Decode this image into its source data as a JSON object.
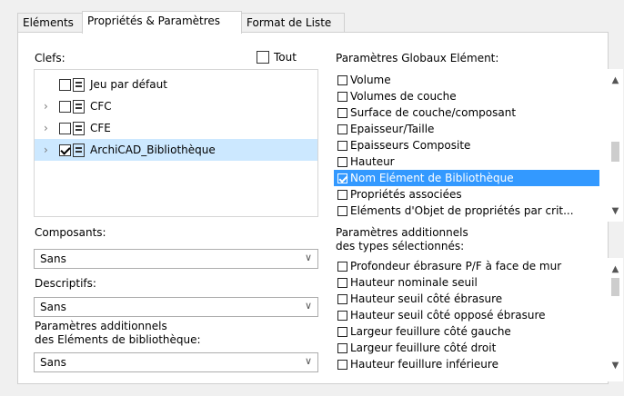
{
  "tabs": [
    {
      "label": "Eléments"
    },
    {
      "label": "Propriétés & Paramètres"
    },
    {
      "label": "Format de Liste"
    }
  ],
  "left": {
    "clefs_label": "Clefs:",
    "tout_label": "Tout",
    "tree": [
      {
        "label": "Jeu par défaut",
        "checked": false,
        "expandable": false
      },
      {
        "label": "CFC",
        "checked": false,
        "expandable": true
      },
      {
        "label": "CFE",
        "checked": false,
        "expandable": true
      },
      {
        "label": "ArchiCAD_Bibliothèque",
        "checked": true,
        "expandable": true
      }
    ],
    "composants_label": "Composants:",
    "composants_value": "Sans",
    "descriptifs_label": "Descriptifs:",
    "descriptifs_value": "Sans",
    "params_label_1": "Paramètres additionnels",
    "params_label_2": "des Eléments de bibliothèque:",
    "params_value": "Sans"
  },
  "right": {
    "global_label": "Paramètres Globaux Elément:",
    "global_items": [
      {
        "label": "Volume",
        "checked": false
      },
      {
        "label": "Volumes de couche",
        "checked": false
      },
      {
        "label": "Surface de couche/composant",
        "checked": false
      },
      {
        "label": "Epaisseur/Taille",
        "checked": false
      },
      {
        "label": "Epaisseurs Composite",
        "checked": false
      },
      {
        "label": "Hauteur",
        "checked": false
      },
      {
        "label": "Nom Elément de Bibliothèque",
        "checked": true
      },
      {
        "label": "Propriétés associées",
        "checked": false
      },
      {
        "label": "Eléments d'Objet de propriétés par crit...",
        "checked": false
      }
    ],
    "additional_label_1": "Paramètres additionnels",
    "additional_label_2": "des types sélectionnés:",
    "additional_items": [
      {
        "label": "Profondeur ébrasure P/F à face de mur",
        "checked": false
      },
      {
        "label": "Hauteur nominale seuil",
        "checked": false
      },
      {
        "label": "Hauteur seuil côté ébrasure",
        "checked": false
      },
      {
        "label": "Hauteur seuil côté opposé ébrasure",
        "checked": false
      },
      {
        "label": "Largeur feuillure côté gauche",
        "checked": false
      },
      {
        "label": "Largeur feuillure côté droit",
        "checked": false
      },
      {
        "label": "Hauteur feuillure inférieure",
        "checked": false
      }
    ]
  }
}
